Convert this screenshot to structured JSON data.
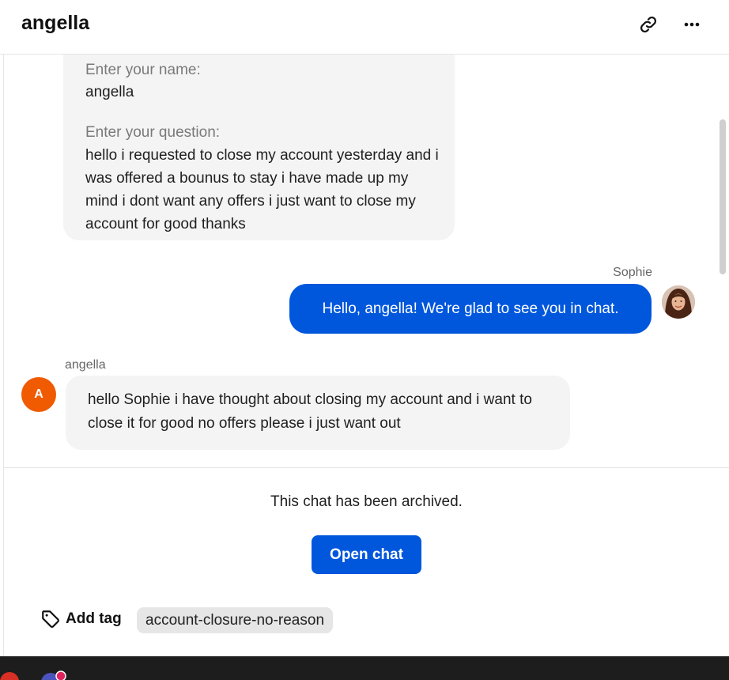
{
  "header": {
    "title": "angella",
    "link_icon": "link-icon",
    "more_icon": "more-horizontal-icon"
  },
  "form_message": {
    "name_label": "Enter your name:",
    "name_value": "angella",
    "question_label": "Enter your question:",
    "question_value": "hello i requested to close my account yesterday and i was offered a bounus to stay i have made up my mind i dont want any offers i just want to close my account for good thanks"
  },
  "agent_message": {
    "author": "Sophie",
    "text": "Hello, angella! We're glad to see you in chat."
  },
  "visitor_message": {
    "author": "angella",
    "avatar_initial": "A",
    "text": "hello Sophie i have thought about closing my account and i want to close it for good no offers please i just want out"
  },
  "archived": {
    "notice": "This chat has been archived.",
    "open_button": "Open chat"
  },
  "tags": {
    "add_label": "Add tag",
    "items": [
      "account-closure-no-reason"
    ]
  },
  "colors": {
    "accent": "#0057dc",
    "visitor_avatar": "#f05a00",
    "bubble_bg": "#f4f4f4",
    "taskbar": "#1d1d1d"
  }
}
